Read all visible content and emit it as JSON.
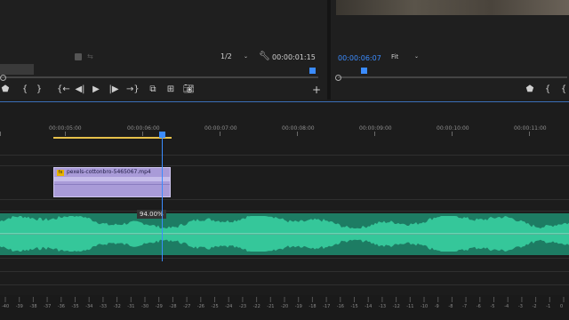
{
  "source_monitor": {
    "resolution": "1/2",
    "timecode": "00:00:01:15"
  },
  "program_monitor": {
    "timecode": "00:00:06:07",
    "zoom": "Fit"
  },
  "transport": {
    "add_button": "+"
  },
  "ruler": {
    "labels": [
      "00:00:05:00",
      "00:00:06:00",
      "00:00:07:00",
      "00:00:08:00",
      "00:00:09:00",
      "00:00:10:00",
      "00:00:11:00"
    ]
  },
  "clip": {
    "name": "pexels-cottonbro-5465067.mp4",
    "fx": "fx"
  },
  "audio": {
    "gain_tooltip": "94.00%"
  },
  "meter": {
    "labels": [
      "-40",
      "-39",
      "-38",
      "-37",
      "-36",
      "-35",
      "-34",
      "-33",
      "-32",
      "-31",
      "-30",
      "-29",
      "-28",
      "-27",
      "-26",
      "-25",
      "-24",
      "-23",
      "-22",
      "-21",
      "-20",
      "-19",
      "-18",
      "-17",
      "-16",
      "-15",
      "-14",
      "-13",
      "-12",
      "-11",
      "-10",
      "-9",
      "-8",
      "-7",
      "-6",
      "-5",
      "-4",
      "-3",
      "-2",
      "-1",
      "0"
    ]
  },
  "colors": {
    "accent": "#3b8cff",
    "clip": "#a99bd8",
    "audio": "#2fae86",
    "in_out": "#e6c04a"
  }
}
